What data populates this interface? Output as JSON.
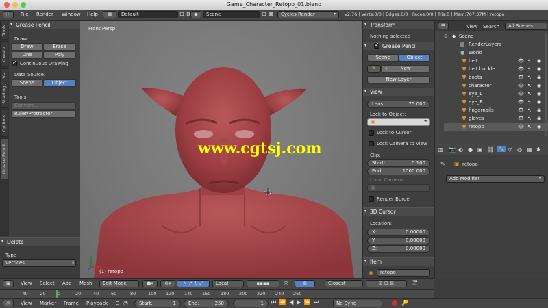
{
  "window": {
    "title": "Game_Character_Retopo_01.blend"
  },
  "topbar": {
    "menus": [
      "File",
      "Render",
      "Window",
      "Help"
    ],
    "layout": "Default",
    "scene": "Scene",
    "engine": "Cycles Render",
    "stats": "v2.76 | Verts:0/0 | Edges:0/0 | Faces:0/0 | Tris:0 | Mem:767.37M | retopo"
  },
  "left_tabs": [
    "Tools",
    "Create",
    "Shading / UVs",
    "Options",
    "Grease Pencil"
  ],
  "tool_panel": {
    "header": "Grease Pencil",
    "draw_label": "Draw:",
    "draw": "Draw",
    "erase": "Erase",
    "line": "Line",
    "poly": "Poly",
    "continuous": "Continuous Drawing",
    "data_source": "Data Source:",
    "scene": "Scene",
    "object": "Object",
    "tools_label": "Tools:",
    "convert": "Convert...",
    "ruler": "Ruler/Protractor"
  },
  "operator_panel": {
    "header": "Delete",
    "type_label": "Type",
    "type_value": "Vertices"
  },
  "viewport": {
    "view_name": "Front Persp",
    "object_label": "(1) retopo",
    "watermark": "www.cgtsj.com"
  },
  "properties_n": {
    "transform": "Transform",
    "nothing_selected": "Nothing selected",
    "grease_pencil": "Grease Pencil",
    "scene": "Scene",
    "object": "Object",
    "new": "New",
    "new_layer": "New Layer",
    "view": "View",
    "lens_label": "Lens:",
    "lens_value": "75.000",
    "lock_to_object": "Lock to Object:",
    "lock_to_cursor": "Lock to Cursor",
    "lock_camera": "Lock Camera to View",
    "clip": "Clip:",
    "start_label": "Start:",
    "start_value": "0.100",
    "end_label": "End:",
    "end_value": "1000.000",
    "local_camera": "Local Camera:",
    "render_border": "Render Border",
    "cursor_3d": "3D Cursor",
    "location": "Location:",
    "x_label": "X:",
    "x_value": "0.00000",
    "y_label": "Y:",
    "y_value": "0.00000",
    "z_label": "Z:",
    "z_value": "0.00000",
    "item": "Item",
    "item_name": "retopo"
  },
  "outliner": {
    "view": "View",
    "search": "Search",
    "filter": "All Scenes",
    "rows": [
      {
        "name": "Scene",
        "indent": 0
      },
      {
        "name": "RenderLayers",
        "indent": 1
      },
      {
        "name": "World",
        "indent": 1
      },
      {
        "name": "belt",
        "indent": 1
      },
      {
        "name": "belt buckle",
        "indent": 1
      },
      {
        "name": "boots",
        "indent": 1
      },
      {
        "name": "character",
        "indent": 1
      },
      {
        "name": "eye_L",
        "indent": 1
      },
      {
        "name": "eye_R",
        "indent": 1
      },
      {
        "name": "fingernails",
        "indent": 1
      },
      {
        "name": "gloves",
        "indent": 1
      },
      {
        "name": "retopo",
        "indent": 1
      }
    ]
  },
  "modifier_panel": {
    "object_name": "retopo",
    "add_modifier": "Add Modifier"
  },
  "viewport_header": {
    "view": "View",
    "select": "Select",
    "add": "Add",
    "mesh": "Mesh",
    "mode": "Edit Mode",
    "pivot": "Local",
    "snap": "Closest"
  },
  "timeline": {
    "ticks": [
      "-40",
      "-20",
      "0",
      "20",
      "40",
      "60",
      "80",
      "100",
      "120",
      "140",
      "160",
      "180",
      "200",
      "220",
      "240",
      "260"
    ],
    "view": "View",
    "marker": "Marker",
    "frame": "Frame",
    "playback": "Playback",
    "start_label": "Start:",
    "start_value": "1",
    "end_label": "End:",
    "end_value": "250",
    "current": "1",
    "sync": "No Sync"
  },
  "colors": {
    "accent_blue": "#5680c2",
    "mesh_red": "#a8464a",
    "viewport_bg": "#7c7c7c"
  }
}
